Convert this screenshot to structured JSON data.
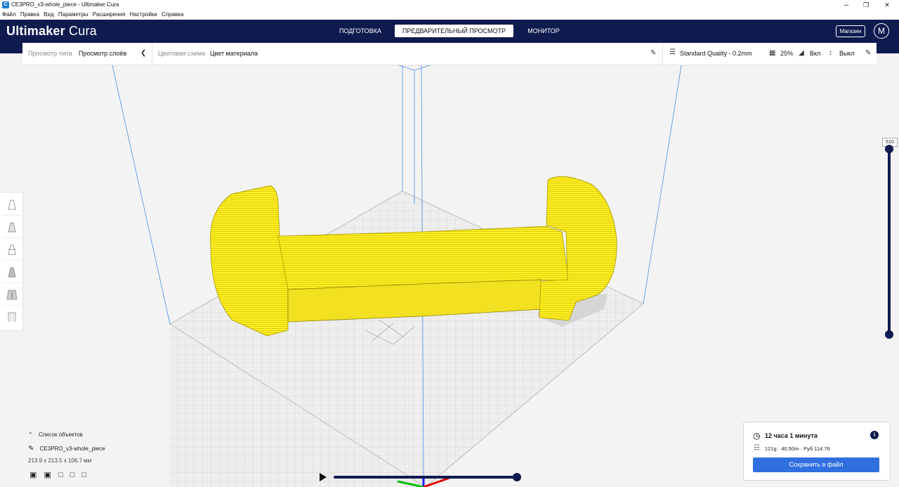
{
  "window": {
    "title": "CE3PRO_v3-whole_piece - Ultimaker Cura",
    "app_icon_letter": "C",
    "minimize": "─",
    "restore": "❐",
    "close": "✕"
  },
  "menubar": [
    "Файл",
    "Правка",
    "Вид",
    "Параметры",
    "Расширения",
    "Настройки",
    "Справка"
  ],
  "header": {
    "logo_brand": "Ultimaker",
    "logo_product": "Cura",
    "tabs": [
      {
        "label": "ПОДГОТОВКА",
        "active": false
      },
      {
        "label": "ПРЕДВАРИТЕЛЬНЫЙ ПРОСМОТР",
        "active": true
      },
      {
        "label": "МОНИТОР",
        "active": false
      }
    ],
    "marketplace": "Магазин",
    "avatar_initial": "M"
  },
  "view_bar": {
    "view_type_label": "Просмотр типа",
    "view_type_value": "Просмотр слоёв",
    "color_scheme_label": "Цветовая схема",
    "color_scheme_value": "Цвет материала",
    "quality": "Standard Quality - 0.2mm",
    "infill": "25%",
    "support": "Вкл",
    "adhesion": "Выкл"
  },
  "layer_slider": {
    "value": "510"
  },
  "object_list": {
    "toggle_label": "Список объектов",
    "object_name": "CE3PRO_v3-whole_piece",
    "dimensions": "213.9 x 213.5 x 106.7 мм"
  },
  "print_info": {
    "time": "12 часа 1 минута",
    "material": "121g · 40.50m · Руб 114.76",
    "save_button": "Сохранить в файл"
  },
  "colors": {
    "header": "#0f1a4f",
    "model": "#ffee22",
    "accent": "#2f6fe0"
  }
}
